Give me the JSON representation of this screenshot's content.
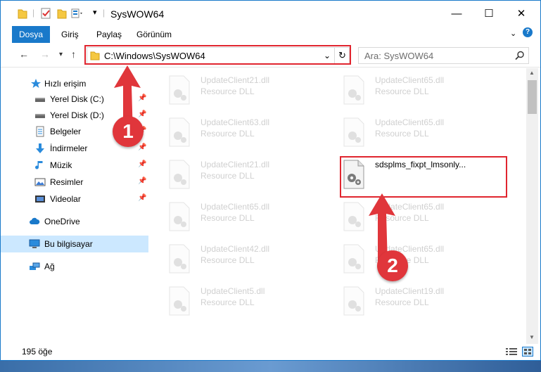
{
  "title": "SysWOW64",
  "ribbon": {
    "tabs": [
      "Dosya",
      "Giriş",
      "Paylaş",
      "Görünüm"
    ]
  },
  "address": {
    "path": "C:\\Windows\\SysWOW64"
  },
  "search": {
    "placeholder": "Ara: SysWOW64"
  },
  "sidebar": {
    "items": [
      {
        "label": "Hızlı erişim",
        "icon": "star-icon"
      },
      {
        "label": "Yerel Disk (C:)",
        "icon": "drive-icon"
      },
      {
        "label": "Yerel Disk (D:)",
        "icon": "drive-icon"
      },
      {
        "label": "Belgeler",
        "icon": "documents-icon"
      },
      {
        "label": "İndirmeler",
        "icon": "download-icon"
      },
      {
        "label": "Müzik",
        "icon": "music-icon"
      },
      {
        "label": "Resimler",
        "icon": "pictures-icon"
      },
      {
        "label": "Videolar",
        "icon": "videos-icon"
      },
      {
        "label": "OneDrive",
        "icon": "cloud-icon"
      },
      {
        "label": "Bu bilgisayar",
        "icon": "computer-icon"
      },
      {
        "label": "Ağ",
        "icon": "network-icon"
      }
    ]
  },
  "files": {
    "left": [
      {
        "name": "UpdateClient21.dll",
        "type": "Resource DLL"
      },
      {
        "name": "UpdateClient63.dll",
        "type": "Resource DLL"
      },
      {
        "name": "UpdateClient21.dll",
        "type": "Resource DLL"
      },
      {
        "name": "UpdateClient65.dll",
        "type": "Resource DLL"
      },
      {
        "name": "UpdateClient42.dll",
        "type": "Resource DLL"
      },
      {
        "name": "UpdateClient5.dll",
        "type": "Resource DLL"
      }
    ],
    "right": [
      {
        "name": "UpdateClient65.dll",
        "type": "Resource DLL"
      },
      {
        "name": "UpdateClient65.dll",
        "type": "Resource DLL"
      },
      {
        "name": "sdsplms_fixpt_lmsonly...",
        "type": ""
      },
      {
        "name": "UpdateClient65.dll",
        "type": "Resource DLL"
      },
      {
        "name": "UpdateClient65.dll",
        "type": "Resource DLL"
      },
      {
        "name": "UpdateClient19.dll",
        "type": "Resource DLL"
      }
    ]
  },
  "status": {
    "count": "195 öğe"
  },
  "annotations": {
    "step1": "1",
    "step2": "2"
  },
  "colors": {
    "accent": "#1979ca",
    "annotation": "#e0252f"
  }
}
